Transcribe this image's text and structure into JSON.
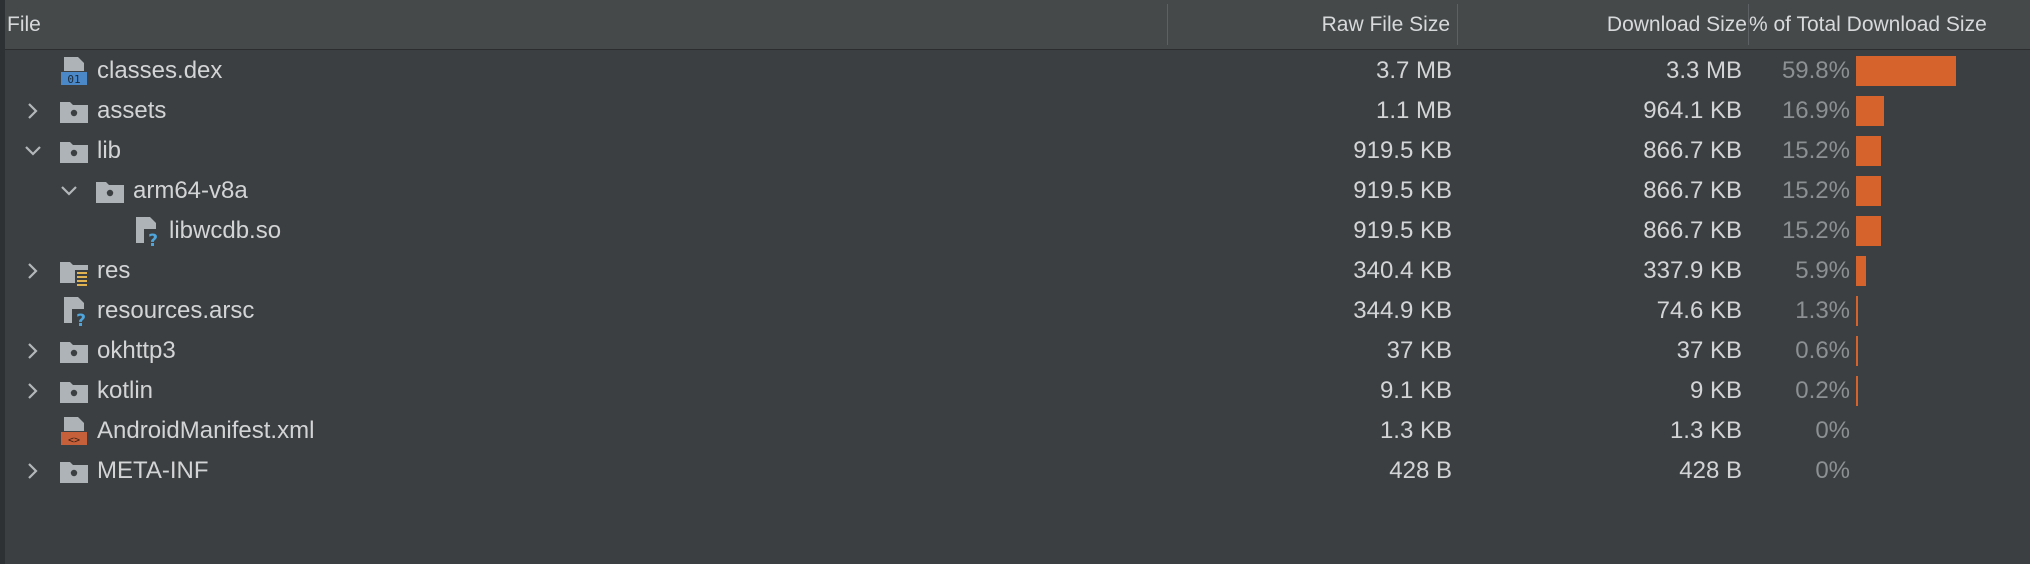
{
  "header": {
    "file": "File",
    "raw_file_size": "Raw File Size",
    "download_size": "Download Size",
    "percent_total": "% of Total Download Size"
  },
  "colors": {
    "bar": "#d5632b",
    "folder": "#aeb3b8",
    "dex_blue": "#4a88c7",
    "xml_orange": "#c5603a",
    "question_blue": "#4ea6dc"
  },
  "rows": [
    {
      "name": "classes.dex",
      "icon": "dex-file-icon",
      "expander": "none",
      "raw": "3.7 MB",
      "download": "3.3 MB",
      "percent_label": "59.8%",
      "percent": 59.8
    },
    {
      "name": "assets",
      "icon": "folder-icon",
      "expander": "collapsed",
      "raw": "1.1 MB",
      "download": "964.1 KB",
      "percent_label": "16.9%",
      "percent": 16.9
    },
    {
      "name": "lib",
      "icon": "folder-icon",
      "expander": "expanded",
      "raw": "919.5 KB",
      "download": "866.7 KB",
      "percent_label": "15.2%",
      "percent": 15.2
    },
    {
      "name": "arm64-v8a",
      "icon": "folder-icon",
      "expander": "expanded",
      "raw": "919.5 KB",
      "download": "866.7 KB",
      "percent_label": "15.2%",
      "percent": 15.2
    },
    {
      "name": "libwcdb.so",
      "icon": "unknown-file-icon",
      "expander": "none",
      "raw": "919.5 KB",
      "download": "866.7 KB",
      "percent_label": "15.2%",
      "percent": 15.2
    },
    {
      "name": "res",
      "icon": "resource-folder-icon",
      "expander": "collapsed",
      "raw": "340.4 KB",
      "download": "337.9 KB",
      "percent_label": "5.9%",
      "percent": 5.9
    },
    {
      "name": "resources.arsc",
      "icon": "unknown-file-icon",
      "expander": "none",
      "raw": "344.9 KB",
      "download": "74.6 KB",
      "percent_label": "1.3%",
      "percent": 1.3
    },
    {
      "name": "okhttp3",
      "icon": "folder-icon",
      "expander": "collapsed",
      "raw": "37 KB",
      "download": "37 KB",
      "percent_label": "0.6%",
      "percent": 0.6
    },
    {
      "name": "kotlin",
      "icon": "folder-icon",
      "expander": "collapsed",
      "raw": "9.1 KB",
      "download": "9 KB",
      "percent_label": "0.2%",
      "percent": 0.2
    },
    {
      "name": "AndroidManifest.xml",
      "icon": "xml-file-icon",
      "expander": "none",
      "raw": "1.3 KB",
      "download": "1.3 KB",
      "percent_label": "0%",
      "percent": 0
    },
    {
      "name": "META-INF",
      "icon": "folder-icon",
      "expander": "collapsed",
      "raw": "428 B",
      "download": "428 B",
      "percent_label": "0%",
      "percent": 0
    }
  ]
}
